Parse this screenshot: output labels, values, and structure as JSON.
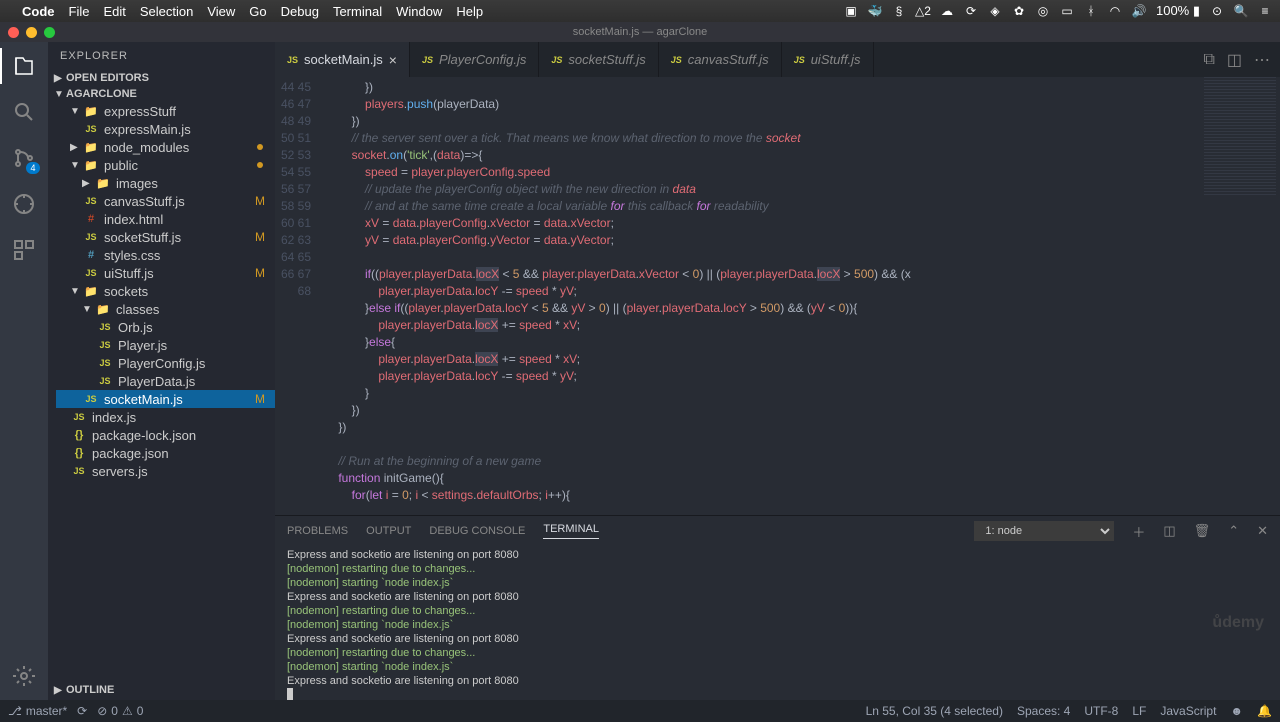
{
  "menubar": {
    "app": "Code",
    "items": [
      "File",
      "Edit",
      "Selection",
      "View",
      "Go",
      "Debug",
      "Terminal",
      "Window",
      "Help"
    ],
    "notif_badge": "2",
    "battery": "100%",
    "clock_icon": "⏱"
  },
  "titlebar": "socketMain.js — agarClone",
  "sidebar": {
    "title": "EXPLORER",
    "sections": {
      "open_editors": "OPEN EDITORS",
      "outline": "OUTLINE"
    },
    "project": "AGARCLONE",
    "tree": {
      "expressStuff": "expressStuff",
      "expressMain": "expressMain.js",
      "node_modules": "node_modules",
      "public": "public",
      "images": "images",
      "canvasStuff": "canvasStuff.js",
      "index_html": "index.html",
      "socketStuff": "socketStuff.js",
      "styles_css": "styles.css",
      "uiStuff": "uiStuff.js",
      "sockets": "sockets",
      "classes": "classes",
      "orb": "Orb.js",
      "player": "Player.js",
      "playerConfig": "PlayerConfig.js",
      "playerData": "PlayerData.js",
      "socketMain": "socketMain.js",
      "index_js": "index.js",
      "package_lock": "package-lock.json",
      "package_json": "package.json",
      "servers": "servers.js"
    }
  },
  "tabs": {
    "socketMain": "socketMain.js",
    "playerConfig": "PlayerConfig.js",
    "socketStuff": "socketStuff.js",
    "canvasStuff": "canvasStuff.js",
    "uiStuff": "uiStuff.js"
  },
  "editor": {
    "lines_start": 44,
    "lines": [
      "            })",
      "            players.push(playerData)",
      "        })",
      "        // the server sent over a tick. That means we know what direction to move the socket",
      "        socket.on('tick',(data)=>{",
      "            speed = player.playerConfig.speed",
      "            // update the playerConfig object with the new direction in data",
      "            // and at the same time create a local variable for this callback for readability",
      "            xV = data.playerConfig.xVector = data.xVector;",
      "            yV = data.playerConfig.yVector = data.yVector;",
      "",
      "            if((player.playerData.locX < 5 && player.playerData.xVector < 0) || (player.playerData.locX > 500) && (x",
      "                player.playerData.locY -= speed * yV;",
      "            }else if((player.playerData.locY < 5 && yV > 0) || (player.playerData.locY > 500) && (yV < 0)){",
      "                player.playerData.locX += speed * xV;",
      "            }else{",
      "                player.playerData.locX += speed * xV;",
      "                player.playerData.locY -= speed * yV;",
      "            }",
      "        })",
      "    })",
      "",
      "    // Run at the beginning of a new game",
      "    function initGame(){",
      "        for(let i = 0; i < settings.defaultOrbs; i++){"
    ]
  },
  "panel": {
    "tabs": {
      "problems": "PROBLEMS",
      "output": "OUTPUT",
      "debug": "DEBUG CONSOLE",
      "terminal": "TERMINAL"
    },
    "select": "1: node",
    "lines": [
      {
        "t": "Express and socketio are listening on port 8080",
        "c": ""
      },
      {
        "t": "[nodemon] restarting due to changes...",
        "c": "g"
      },
      {
        "t": "[nodemon] starting `node index.js`",
        "c": "g"
      },
      {
        "t": "Express and socketio are listening on port 8080",
        "c": ""
      },
      {
        "t": "[nodemon] restarting due to changes...",
        "c": "g"
      },
      {
        "t": "[nodemon] starting `node index.js`",
        "c": "g"
      },
      {
        "t": "Express and socketio are listening on port 8080",
        "c": ""
      },
      {
        "t": "[nodemon] restarting due to changes...",
        "c": "g"
      },
      {
        "t": "[nodemon] starting `node index.js`",
        "c": "g"
      },
      {
        "t": "Express and socketio are listening on port 8080",
        "c": ""
      }
    ]
  },
  "statusbar": {
    "branch": "master*",
    "errors": "0",
    "warnings": "0",
    "cursor": "Ln 55, Col 35 (4 selected)",
    "spaces": "Spaces: 4",
    "encoding": "UTF-8",
    "eol": "LF",
    "lang": "JavaScript",
    "feedback": "☻"
  },
  "scm_badge": "4",
  "watermark": "ůdemy"
}
